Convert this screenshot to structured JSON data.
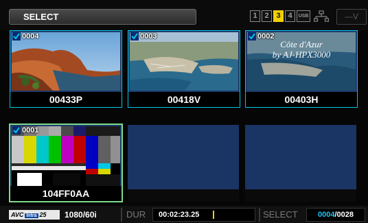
{
  "header": {
    "mode_label": "SELECT",
    "slots": [
      {
        "label": "1",
        "active": false
      },
      {
        "label": "2",
        "active": false
      },
      {
        "label": "3",
        "active": true
      },
      {
        "label": "4",
        "active": false
      },
      {
        "label": "USB",
        "active": false
      }
    ],
    "vbox_label": "—V"
  },
  "clips": [
    {
      "number": "0004",
      "caption": "00433P",
      "checked": true,
      "scene": "mountain-coast"
    },
    {
      "number": "0003",
      "caption": "00418V",
      "checked": true,
      "scene": "aerial-harbor"
    },
    {
      "number": "0002",
      "caption": "00403H",
      "checked": true,
      "scene": "cote-dazur",
      "overlay": [
        "Côte d'Azur",
        "by AJ-HPX3000"
      ]
    },
    {
      "number": "0001",
      "caption": "104FF0AA",
      "checked": true,
      "scene": "color-bars",
      "highlighted": true
    },
    {
      "empty": true
    },
    {
      "empty": true
    }
  ],
  "footer": {
    "codec_prefix": "AVC",
    "codec_intra": "Intra",
    "codec_suffix": "25",
    "format": "1080/60i",
    "dur_label": "DUR",
    "duration": "00:02:23.25",
    "duration_progress": 0.03,
    "select_label": "SELECT",
    "select_current": "0004",
    "select_total": "/0028"
  },
  "colors": {
    "clip_border": "#00c8e8",
    "selected_border": "#7fdc8c",
    "active_slot": "#f4d000",
    "empty_tile": "#1a3463"
  }
}
